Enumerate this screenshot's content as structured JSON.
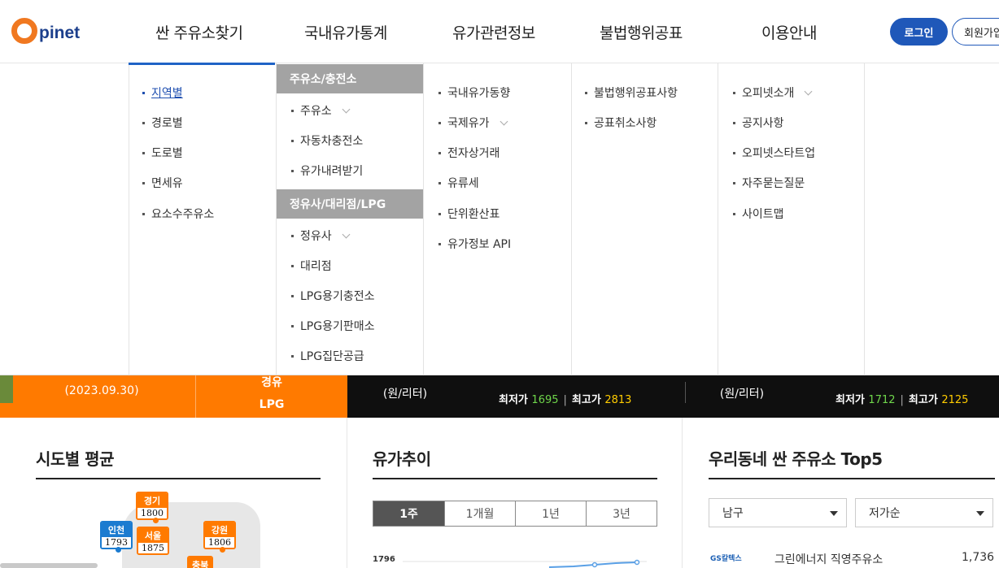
{
  "header": {
    "logo_text": "pinet",
    "nav": [
      "싼 주유소찾기",
      "국내유가통계",
      "유가관련정보",
      "불법행위공표",
      "이용안내"
    ],
    "login_label": "로그인",
    "join_label": "회원가입"
  },
  "mega_menu": {
    "col1": [
      "지역별",
      "경로별",
      "도로별",
      "면세유",
      "요소수주유소"
    ],
    "col2": {
      "head1": "주유소/충전소",
      "group1": [
        "주유소",
        "자동차충전소",
        "유가내려받기"
      ],
      "head2": "정유사/대리점/LPG",
      "group2": [
        "정유사",
        "대리점",
        "LPG용기충전소",
        "LPG용기판매소",
        "LPG집단공급"
      ]
    },
    "col3": [
      "국내유가동향",
      "국제유가",
      "전자상거래",
      "유류세",
      "단위환산표",
      "유가정보 API"
    ],
    "col4": [
      "불법행위공표사항",
      "공표취소사항"
    ],
    "col5": [
      "오피넷소개",
      "공지사항",
      "오피넷스타트업",
      "자주묻는질문",
      "사이트맵"
    ]
  },
  "banner": {
    "date": "(2023.09.30)",
    "tab_diesel": "경유",
    "tab_lpg": "LPG",
    "unit1": "(원/리터)",
    "unit2": "(원/리터)",
    "min_label": "최저가",
    "max_label": "최고가",
    "left": {
      "min": "1695",
      "max": "2813"
    },
    "right": {
      "min": "1712",
      "max": "2125"
    }
  },
  "panels": {
    "sido_title": "시도별 평균",
    "trend_title": "유가추이",
    "top5_title": "우리동네 싼 주유소 Top5"
  },
  "regions": [
    {
      "name": "경기",
      "value": "1800",
      "color": "orange"
    },
    {
      "name": "인천",
      "value": "1793",
      "color": "blue"
    },
    {
      "name": "서울",
      "value": "1875",
      "color": "orange"
    },
    {
      "name": "강원",
      "value": "1806",
      "color": "orange"
    },
    {
      "name": "충북",
      "value": "",
      "color": "orange"
    }
  ],
  "trend": {
    "periods": [
      "1주",
      "1개월",
      "1년",
      "3년"
    ],
    "y_tick": "1796"
  },
  "top5": {
    "district": "남구",
    "sort": "저가순",
    "brand": "GS칼텍스",
    "station": "그린에너지 직영주유소",
    "price": "1,736"
  },
  "colors": {
    "accent_orange": "#ff7a00",
    "brand_blue": "#1f58b9",
    "low_green": "#6fd64b",
    "high_yellow": "#ffcc00"
  }
}
